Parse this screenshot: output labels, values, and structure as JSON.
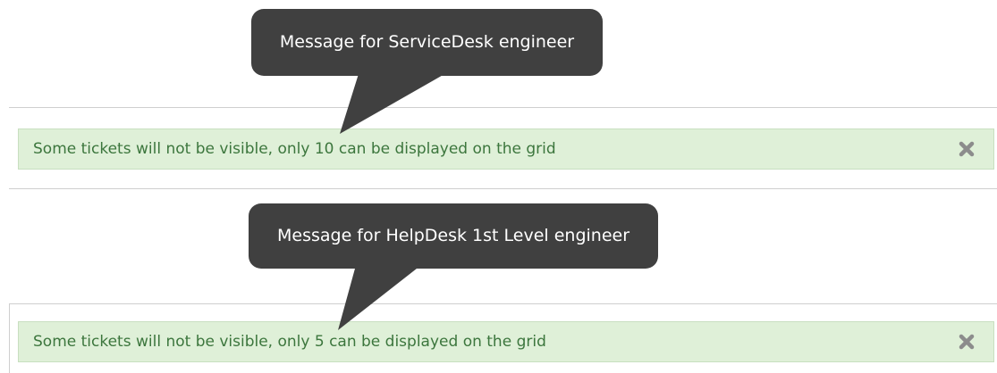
{
  "callouts": [
    {
      "text": "Message for ServiceDesk engineer"
    },
    {
      "text": "Message for HelpDesk 1st Level engineer"
    }
  ],
  "alerts": [
    {
      "message": "Some tickets will not be visible, only 10 can be displayed on the grid",
      "close_icon": "close-x-icon"
    },
    {
      "message": "Some tickets will not be visible, only 5 can be displayed on the grid",
      "close_icon": "close-x-icon"
    }
  ],
  "colors": {
    "alert_background": "#dff0d8",
    "alert_text": "#3c763d",
    "callout_background": "#404040",
    "callout_text": "#ffffff",
    "close_icon": "#8c8c8c"
  }
}
